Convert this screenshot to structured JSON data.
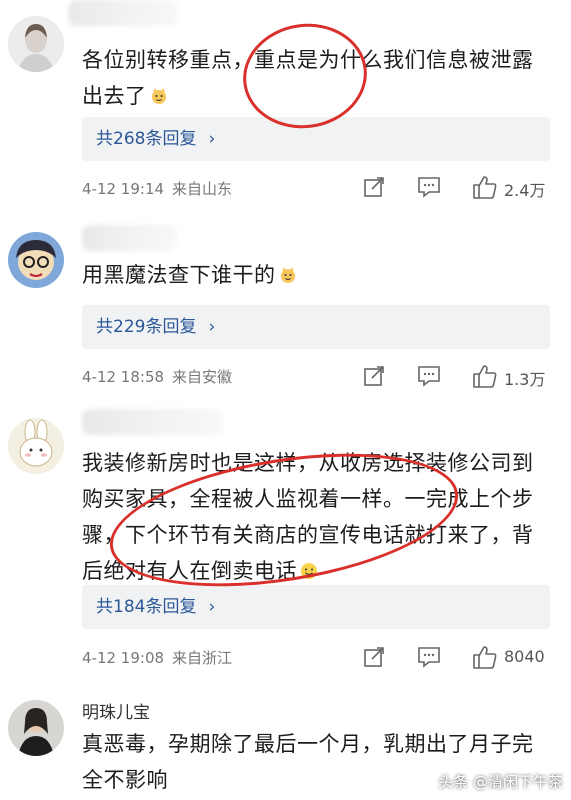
{
  "comments": [
    {
      "text_lines": [
        "各位别转移重点，重点是为什么我们信息被泄露",
        "出去了"
      ],
      "reply_label": "共268条回复",
      "time": "4-12 19:14",
      "location": "来自山东",
      "likes": "2.4万"
    },
    {
      "text_lines": [
        "用黑魔法查下谁干的"
      ],
      "reply_label": "共229条回复",
      "time": "4-12 18:58",
      "location": "来自安徽",
      "likes": "1.3万"
    },
    {
      "text_lines": [
        "我装修新房时也是这样，从收房选择装修公司到",
        "购买家具，全程被人监视着一样。一完成上个步",
        "骤，下个环节有关商店的宣传电话就打来了，背",
        "后绝对有人在倒卖电话"
      ],
      "reply_label": "共184条回复",
      "time": "4-12 19:08",
      "location": "来自浙江",
      "likes": "8040"
    },
    {
      "username": "明珠儿宝",
      "text_lines": [
        "真恶毒，孕期除了最后一个月，乳期出了月子完",
        "全不影响"
      ]
    }
  ],
  "icons": {
    "share": "share-icon",
    "comment": "comment-icon",
    "like": "thumbs-up-icon",
    "chevron": "›"
  },
  "colors": {
    "reply_link": "#2b5797",
    "annotation_circle": "#d9302b",
    "reply_box_bg": "#f1f2f4"
  },
  "watermark": "头条 @清闲下午茶"
}
